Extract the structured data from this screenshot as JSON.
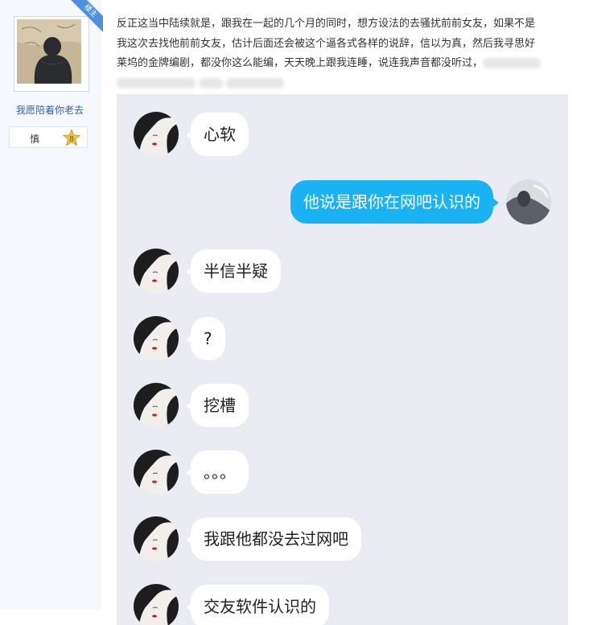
{
  "author": {
    "name": "我愿陪着你老去",
    "badge": "楼主",
    "level_name": "慎",
    "level_number": "8"
  },
  "post": {
    "line1": "反正这当中陆续就是，跟我在一起的几个月的同时，想方设法的去骚扰前前女友，如果不是",
    "line2": "我这次去找他前前女友，估计后面还会被这个逼各式各样的说辞，信以为真，然后我寻思好",
    "line3": "莱坞的金牌编剧，都没你这么能编，天天晚上跟我连睡，说连我声音都没听过，"
  },
  "chat": {
    "messages": [
      {
        "side": "in",
        "text": "心软"
      },
      {
        "side": "out",
        "text": "他说是跟你在网吧认识的"
      },
      {
        "side": "in",
        "text": "半信半疑"
      },
      {
        "side": "in",
        "text": "?"
      },
      {
        "side": "in",
        "text": "挖槽"
      },
      {
        "side": "in",
        "text": "。。。"
      },
      {
        "side": "in",
        "text": "我跟他都没去过网吧"
      },
      {
        "side": "in",
        "text": "交友软件认识的"
      }
    ]
  },
  "colors": {
    "incoming_bubble": "#ffffff",
    "outgoing_bubble": "#1bb2f3",
    "chat_background": "#ebebf3",
    "username": "#2d64b3"
  },
  "icons": {
    "badge": "corner-ribbon-icon",
    "level": "star-badge-icon"
  }
}
